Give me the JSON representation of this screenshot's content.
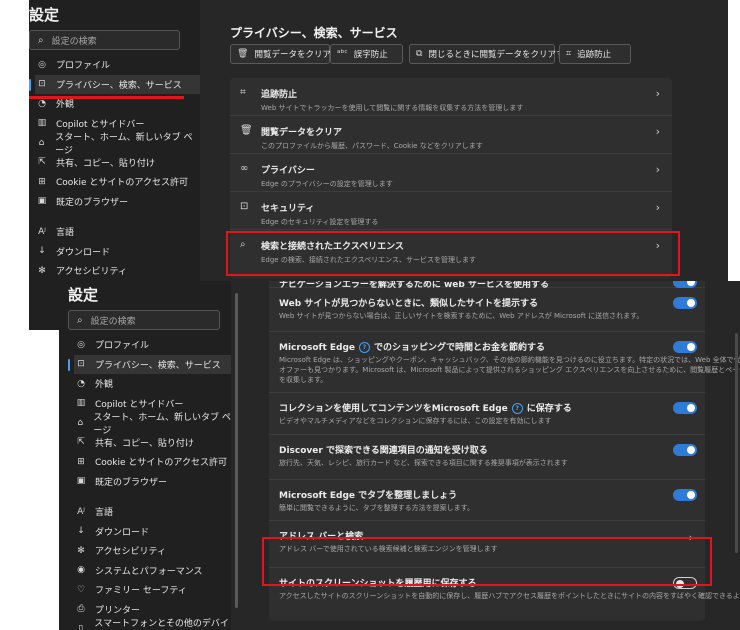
{
  "top": {
    "title": "設定",
    "search_placeholder": "設定の検索",
    "sidebar": [
      {
        "label": "プロファイル",
        "icon": "person-icon"
      },
      {
        "label": "プライバシー、検索、サービス",
        "icon": "lock-icon",
        "active": true
      },
      {
        "label": "外観",
        "icon": "appearance-icon"
      },
      {
        "label": "Copilot とサイドバー",
        "icon": "sidebar-icon"
      },
      {
        "label": "スタート、ホーム、新しいタブ ページ",
        "icon": "home-icon"
      },
      {
        "label": "共有、コピー、貼り付け",
        "icon": "share-icon"
      },
      {
        "label": "Cookie とサイトのアクセス許可",
        "icon": "cookie-icon"
      },
      {
        "label": "既定のブラウザー",
        "icon": "browser-icon"
      },
      {
        "label": "言語",
        "icon": "language-icon",
        "gap": true
      },
      {
        "label": "ダウンロード",
        "icon": "download-icon"
      },
      {
        "label": "アクセシビリティ",
        "icon": "accessibility-icon"
      }
    ],
    "heading": "プライバシー、検索、サービス",
    "quick_buttons": [
      {
        "label": "閲覧データをクリア",
        "icon": "trash-icon"
      },
      {
        "label": "誤字防止",
        "icon": "spellcheck-icon"
      },
      {
        "label": "閉じるときに閲覧データをクリアする",
        "icon": "clear-on-close-icon"
      },
      {
        "label": "追跡防止",
        "icon": "tracking-icon"
      }
    ],
    "rows": [
      {
        "title": "追跡防止",
        "desc": "Web サイトでトラッカーを使用して閲覧に関する情報を収集する方法を管理します",
        "icon": "tracking-icon"
      },
      {
        "title": "閲覧データをクリア",
        "desc": "このプロファイルから履歴、パスワード、Cookie などをクリアします",
        "icon": "trash-icon"
      },
      {
        "title": "プライバシー",
        "desc": "Edge のプライバシーの設定を管理します",
        "icon": "glasses-icon"
      },
      {
        "title": "セキュリティ",
        "desc": "Edge のセキュリティ設定を管理する",
        "icon": "lock-icon"
      },
      {
        "title": "検索と接続されたエクスペリエンス",
        "desc": "Edge の検索、接続されたエクスペリエンス、サービスを管理します",
        "icon": "search-icon"
      }
    ]
  },
  "bottom": {
    "title": "設定",
    "search_placeholder": "設定の検索",
    "sidebar": [
      {
        "label": "プロファイル",
        "icon": "person-icon"
      },
      {
        "label": "プライバシー、検索、サービス",
        "icon": "lock-icon",
        "active": true
      },
      {
        "label": "外観",
        "icon": "appearance-icon"
      },
      {
        "label": "Copilot とサイドバー",
        "icon": "sidebar-icon"
      },
      {
        "label": "スタート、ホーム、新しいタブ ページ",
        "icon": "home-icon"
      },
      {
        "label": "共有、コピー、貼り付け",
        "icon": "share-icon"
      },
      {
        "label": "Cookie とサイトのアクセス許可",
        "icon": "cookie-icon"
      },
      {
        "label": "既定のブラウザー",
        "icon": "browser-icon"
      },
      {
        "label": "言語",
        "icon": "language-icon",
        "gap": true
      },
      {
        "label": "ダウンロード",
        "icon": "download-icon"
      },
      {
        "label": "アクセシビリティ",
        "icon": "accessibility-icon"
      },
      {
        "label": "システムとパフォーマンス",
        "icon": "system-icon"
      },
      {
        "label": "ファミリー セーフティ",
        "icon": "family-icon"
      },
      {
        "label": "プリンター",
        "icon": "printer-icon"
      },
      {
        "label": "スマートフォンとその他のデバイス",
        "icon": "phone-icon"
      }
    ],
    "rows": [
      {
        "title": "ナビゲーションエラーを解決するために web サービスを使用する",
        "desc": "",
        "toggle": "on",
        "h": 12
      },
      {
        "title": "Web サイトが見つからないときに、類似したサイトを提示する",
        "desc": "Web サイトが見つからない場合は、正しいサイトを検索するために、Web アドレスが Microsoft に送信されます。",
        "toggle": "on",
        "h": 44
      },
      {
        "title": "Microsoft Edge",
        "title2": "でのショッピングで時間とお金を節約する",
        "help": "?",
        "desc": "Microsoft Edge は、ショッピングやクーポン、キャッシュバック、その他の節約機能を見つけるのに役立ちます。特定の状況では、Web 全体で代替製品",
        "desc2": "オファーも見つかります。Microsoft は、Microsoft 製品によって提供されるショッピング エクスペリエンスを向上させるために、閲覧履歴とページ コンテンツ",
        "desc3": "を収集します。",
        "toggle": "on",
        "h": 61
      },
      {
        "title": "コレクションを使用してコンテンツをMicrosoft Edge",
        "title2": "に保存する",
        "help": "?",
        "desc": "ビデオやマルチメディアなどをコレクションに保存するには、この設定を有効にします",
        "toggle": "on",
        "h": 42
      },
      {
        "title": "Discover で探索できる関連項目の通知を受け取る",
        "desc": "旅行先、天気、レシピ、旅行カード など、探索できる項目に関する推奨事項が表示されます",
        "toggle": "on",
        "h": 45
      },
      {
        "title": "Microsoft Edge でタブを整理しましょう",
        "desc": "簡単に閲覧できるように、タブを整理する方法を提案します。",
        "toggle": "on",
        "h": 41
      },
      {
        "title": "アドレス バーと検索",
        "desc": "アドレス バーで使用されている検索候補と検索エンジンを管理します",
        "chevron": true,
        "h": 47
      },
      {
        "title": "サイトのスクリーンショットを履歴用に保存する",
        "desc": "アクセスしたサイトのスクリーンショットを自動的に保存し、履歴ハブでアクセス履歴をポイントしたときにサイトの内容をすばやく確認できるようにします。",
        "toggle": "off",
        "h": 40
      }
    ]
  },
  "colors": {
    "accent": "#2f7bd8",
    "highlight": "#e0161b",
    "panel": "#272727",
    "sidebar": "#202020"
  }
}
